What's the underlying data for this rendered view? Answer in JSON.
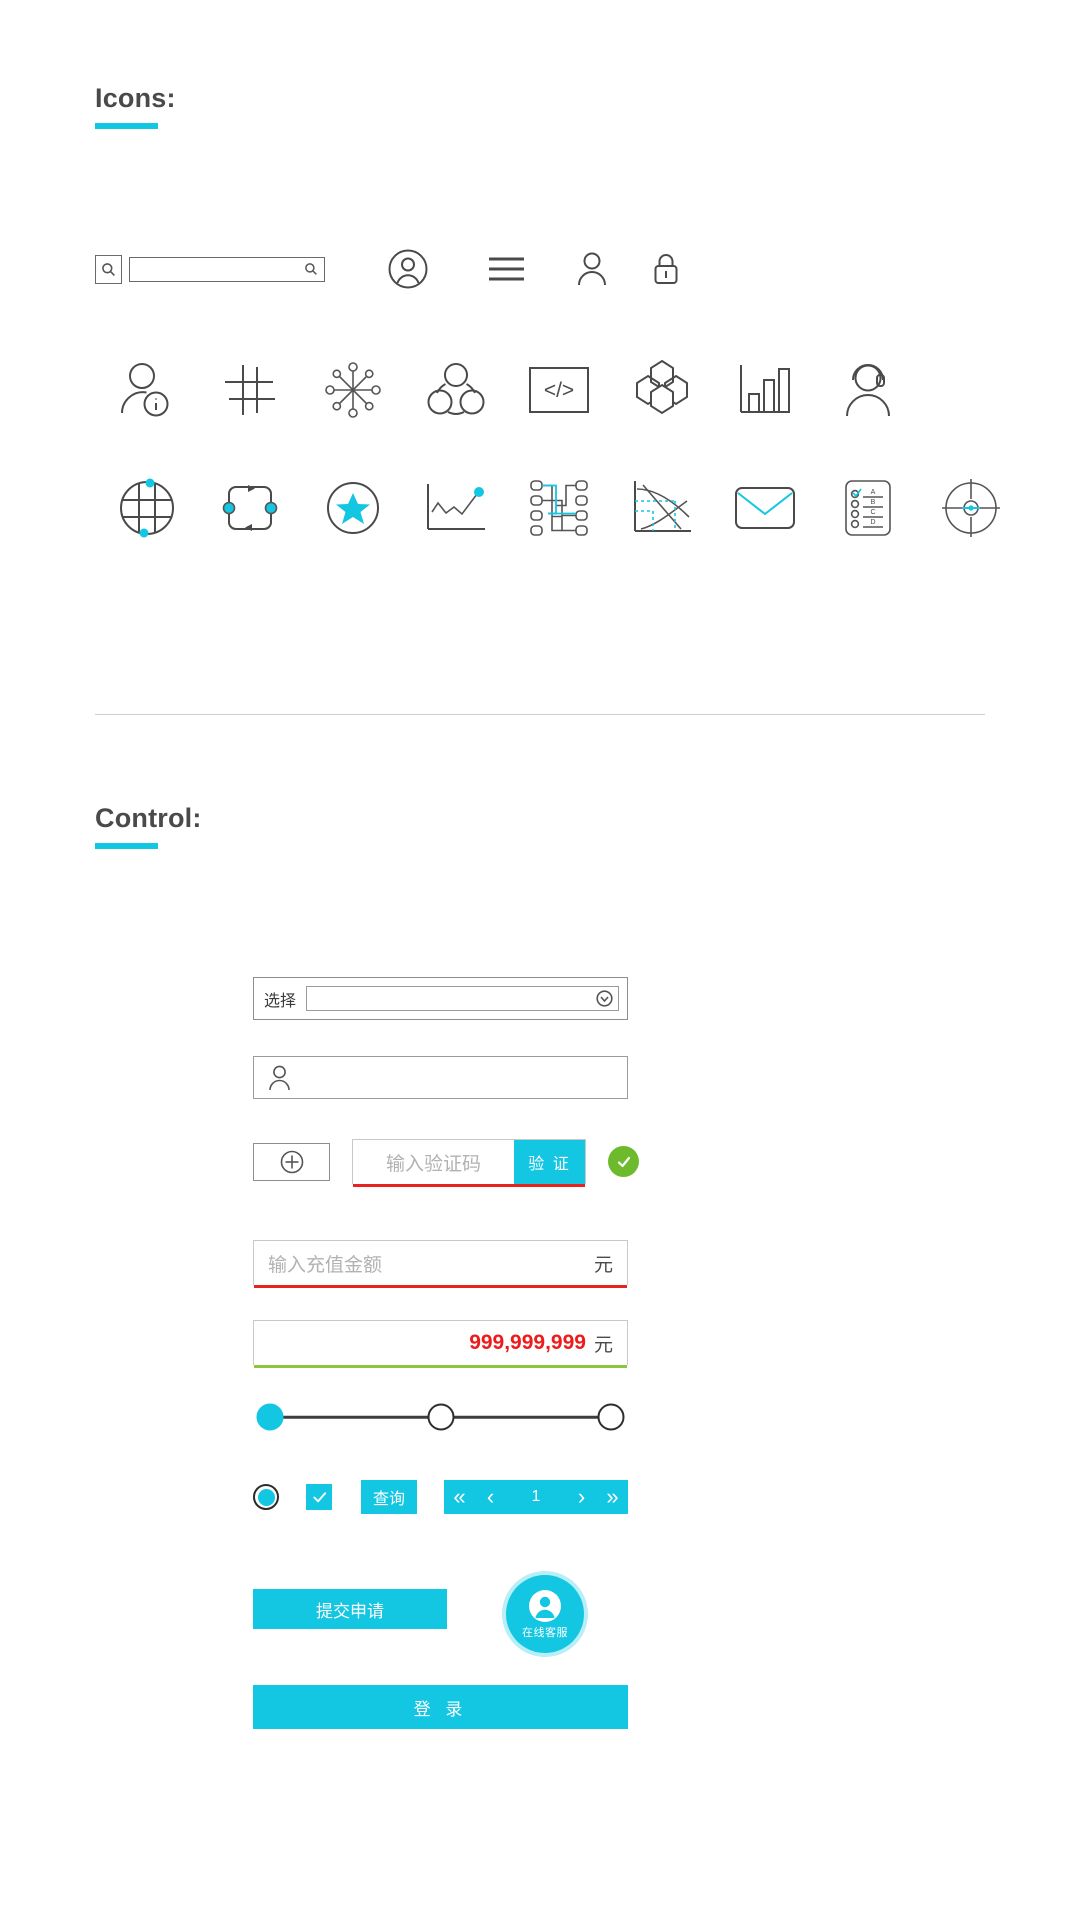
{
  "sections": {
    "icons": {
      "title": "Icons:",
      "accent": "#13c6e2"
    },
    "control": {
      "title": "Control:",
      "accent": "#13c6e2"
    }
  },
  "colors": {
    "accent": "#13c6e2",
    "line": "#4a4a4a",
    "error_red": "#e8231f",
    "value_red": "#ee1b1b",
    "success_green": "#6dbb2c",
    "underline_green": "#8cc63e"
  },
  "icon_rows": [
    {
      "items": [
        {
          "name": "search-bar",
          "label": "search-bar"
        },
        {
          "name": "avatar-circle-icon",
          "label": "avatar-circle"
        },
        {
          "name": "hamburger-menu-icon",
          "label": "menu"
        },
        {
          "name": "user-icon",
          "label": "user"
        },
        {
          "name": "lock-icon",
          "label": "lock"
        }
      ]
    },
    {
      "items": [
        {
          "name": "user-info-icon",
          "label": "user-info"
        },
        {
          "name": "grid-hash-icon",
          "label": "grid"
        },
        {
          "name": "network-hub-icon",
          "label": "network-hub"
        },
        {
          "name": "team-group-icon",
          "label": "team"
        },
        {
          "name": "code-icon",
          "label": "code"
        },
        {
          "name": "hexagon-cluster-icon",
          "label": "hexagon-cluster"
        },
        {
          "name": "bar-chart-icon",
          "label": "bar-chart"
        },
        {
          "name": "headset-support-icon",
          "label": "support-agent"
        }
      ]
    },
    {
      "items": [
        {
          "name": "globe-grid-icon",
          "label": "globe"
        },
        {
          "name": "cycle-loop-icon",
          "label": "cycle"
        },
        {
          "name": "star-circle-icon",
          "label": "favorite"
        },
        {
          "name": "line-chart-icon",
          "label": "trend-chart"
        },
        {
          "name": "circuit-chip-icon",
          "label": "circuit"
        },
        {
          "name": "curve-chart-icon",
          "label": "supply-demand-curve"
        },
        {
          "name": "envelope-icon",
          "label": "mail"
        },
        {
          "name": "survey-list-icon",
          "label": "survey"
        },
        {
          "name": "crosshair-target-icon",
          "label": "target"
        }
      ]
    }
  ],
  "icon_details": {
    "code_glyph": "</>",
    "survey_options": [
      "A",
      "B",
      "C",
      "D"
    ]
  },
  "control": {
    "select": {
      "label": "选择",
      "value": "",
      "placeholder": ""
    },
    "user_input": {
      "value": "",
      "placeholder": ""
    },
    "captcha": {
      "image_glyph": "+",
      "placeholder": "输入验证码",
      "value": "",
      "button_label": "验 证",
      "status": "valid"
    },
    "recharge": {
      "placeholder": "输入充值金额",
      "value": "",
      "unit": "元"
    },
    "amount_display": {
      "value": "999,999,999",
      "unit": "元"
    },
    "slider": {
      "handles": 3,
      "active_index": 0,
      "positions": [
        0,
        50,
        100
      ]
    },
    "radio": {
      "checked": true
    },
    "checkbox": {
      "checked": true
    },
    "query_button": {
      "label": "查询"
    },
    "pagination": {
      "first": "«",
      "prev": "‹",
      "current": "1",
      "next": "›",
      "last": "»"
    },
    "submit_button": {
      "label": "提交申请"
    },
    "customer_service": {
      "label": "在线客服"
    },
    "login_button": {
      "label": "登 录"
    }
  }
}
